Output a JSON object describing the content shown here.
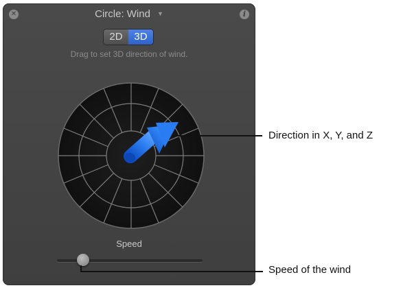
{
  "hud": {
    "title": "Circle: Wind",
    "title_chevron": "▼",
    "close_icon": "close-icon",
    "info_icon": "info-icon",
    "mode_toggle": {
      "options": [
        "2D",
        "3D"
      ],
      "selected": "3D"
    },
    "hint": "Drag to set 3D direction of wind.",
    "direction_control": {
      "arrow_color": "#1f6fe0",
      "grid_color": "#8a8a8a",
      "background": "#141414"
    },
    "speed": {
      "label": "Speed",
      "value_fraction": 0.18
    }
  },
  "callouts": {
    "direction": "Direction in X, Y, and Z",
    "speed": "Speed of the wind"
  }
}
